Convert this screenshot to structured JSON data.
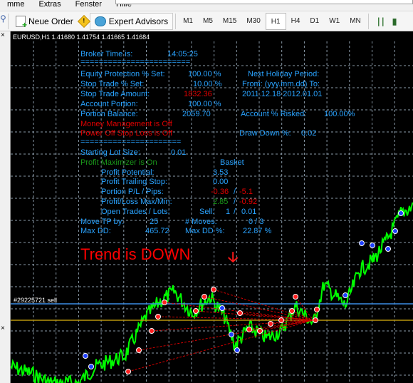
{
  "menu": [
    "mme",
    "Extras",
    "Fenster",
    "Hilfe"
  ],
  "toolbar": {
    "new_order": "Neue Order",
    "expert_advisors": "Expert Advisors",
    "timeframes": [
      "M1",
      "M5",
      "M15",
      "M30",
      "H1",
      "H4",
      "D1",
      "W1",
      "MN"
    ],
    "active_timeframe": "H1"
  },
  "chart": {
    "symbol": "EURUSD,H1  1.41680 1.41754 1.41665 1.41684",
    "order_label": "#29225721 sell",
    "trend": "Trend is DOWN",
    "trend_icon": "arrow-down-icon",
    "colors": {
      "background": "#000000",
      "price": "#00ff00",
      "info": "#29a3ff",
      "alert": "#e00000",
      "positive": "#1a9a1a",
      "order_line": "#3a8ee6",
      "level_line": "#b8960c"
    }
  },
  "panel": {
    "broker_time_label": "Broker Time is:",
    "broker_time": "14:05:25",
    "divider": "========================",
    "equity_label": "Equity Protection % Set:",
    "equity": "100.00 %",
    "stop_pct_label": "Stop Trade % Set:",
    "stop_pct": "10.00 %",
    "stop_amt_label": "Stop Trade Amount:",
    "stop_amt": "1832.36",
    "portion_label": "Account Portion:",
    "portion": "100.00 %",
    "balance_label": "Portion Balance:",
    "balance": "2059.70",
    "mm": "Money Management is Off",
    "psl": "Power Off Stop Loss is Off",
    "holiday_label": "Next Holiday Period:",
    "holiday_fmt": "From: (yyy.mm.dd) To:",
    "holiday_dates": "2011.12.18  2012.01.01",
    "risked_label": "Account % Risked:",
    "risked": "100.00%",
    "dd_label": "Draw Down %:",
    "dd": "0.02",
    "divider2": "======================",
    "lot_label": "Starting Lot Size:",
    "lot": "0.01",
    "pm": "Profit Maximizer is On",
    "basket": "Basket",
    "pp_label": "Profit Potential:",
    "pp": "3.53",
    "pts_label": "Profit Trailing Stop:",
    "pts": "0.00",
    "ppl_label": "Portion P/L / Pips:",
    "ppl": "-0.36",
    "ppl_sep": "/",
    "pips": "-5.1",
    "plmm_label": "Profit/Loss Max/Min:",
    "pl_max": "2.85",
    "pl_sep": "/",
    "pl_min": "-0.92",
    "ot_label": "Open Trades / Lots:",
    "ot_side": "Sell:",
    "ot_count": "1",
    "ot_sep": "/",
    "ot_lots": "0.01",
    "mtp_label": "Move TP by:",
    "mtp": "25",
    "moves_label": "# Moves:",
    "moves": "0 / 3",
    "maxdd_label": "Max DD:",
    "maxdd": "465.72",
    "maxddp_label": "Max DD %:",
    "maxddp": "22.87 %"
  }
}
